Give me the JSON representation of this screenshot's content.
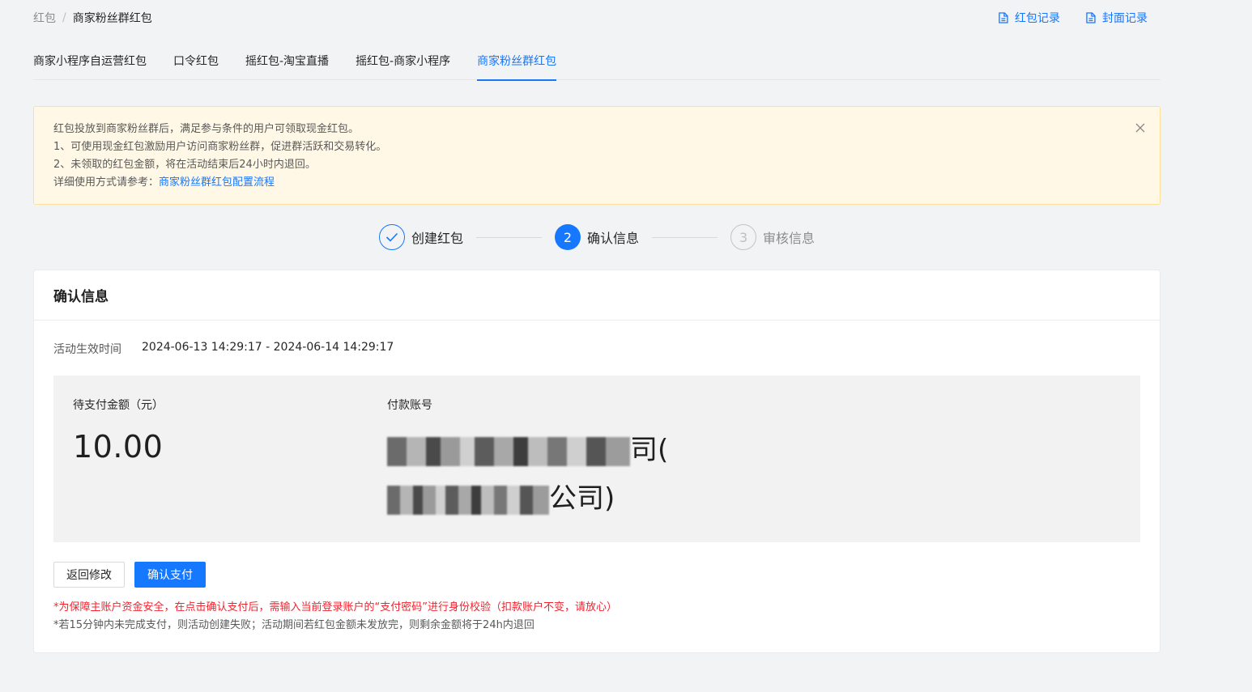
{
  "breadcrumb": {
    "root": "红包",
    "separator": "/",
    "current": "商家粉丝群红包"
  },
  "toplinks": [
    {
      "label": "红包记录",
      "icon": "file-icon"
    },
    {
      "label": "封面记录",
      "icon": "file-icon"
    }
  ],
  "tabs": [
    {
      "label": "商家小程序自运营红包",
      "active": false
    },
    {
      "label": "口令红包",
      "active": false
    },
    {
      "label": "摇红包-淘宝直播",
      "active": false
    },
    {
      "label": "摇红包-商家小程序",
      "active": false
    },
    {
      "label": "商家粉丝群红包",
      "active": true
    }
  ],
  "alert": {
    "line1": "红包投放到商家粉丝群后，满足参与条件的用户可领取现金红包。",
    "line2": "1、可使用现金红包激励用户访问商家粉丝群，促进群活跃和交易转化。",
    "line3": "2、未领取的红包金额，将在活动结束后24小时内退回。",
    "line4_prefix": "详细使用方式请参考：",
    "line4_link": "商家粉丝群红包配置流程"
  },
  "steps": [
    {
      "label": "创建红包",
      "state": "done",
      "number": "1"
    },
    {
      "label": "确认信息",
      "state": "active",
      "number": "2"
    },
    {
      "label": "审核信息",
      "state": "wait",
      "number": "3"
    }
  ],
  "card": {
    "title": "确认信息",
    "time_label": "活动生效时间",
    "time_value": "2024-06-13 14:29:17 - 2024-06-14 14:29:17",
    "amount_label": "待支付金额（元）",
    "amount_value": "10.00",
    "account_label": "付款账号",
    "account_visible_suffix1": "司(",
    "account_visible_suffix2": "公司)",
    "back_button": "返回修改",
    "confirm_button": "确认支付",
    "note_red": "*为保障主账户资金安全，在点击确认支付后，需输入当前登录账户的“支付密码”进行身份校验（扣款账户不变，请放心）",
    "note_gray": "*若15分钟内未完成支付，则活动创建失败；活动期间若红包金额未发放完，则剩余金额将于24h内退回"
  },
  "colors": {
    "primary": "#1677ff",
    "alert_bg": "#fff8e6",
    "alert_border": "#ffe09a",
    "danger": "#f5222d"
  }
}
